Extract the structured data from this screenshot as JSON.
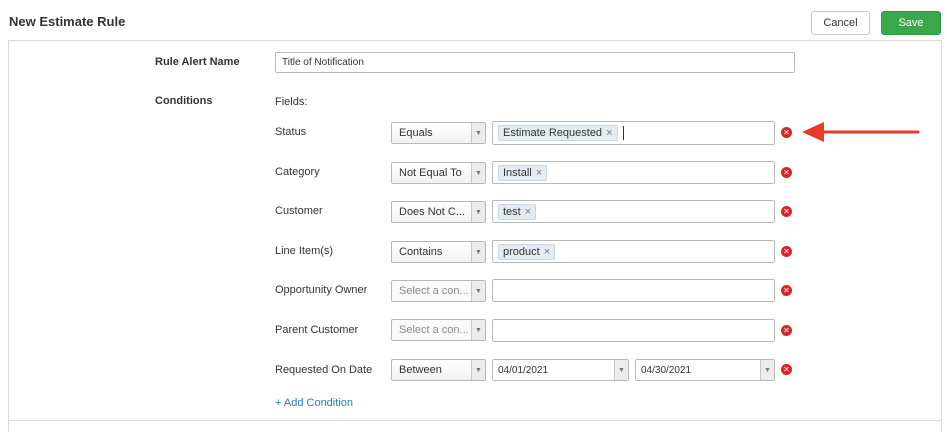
{
  "header": {
    "title": "New Estimate Rule",
    "cancel_label": "Cancel",
    "save_label": "Save"
  },
  "form": {
    "rule_alert_name_label": "Rule Alert Name",
    "rule_alert_name_value": "Title of Notification",
    "conditions_label": "Conditions",
    "fields_label": "Fields:",
    "rows": [
      {
        "field": "Status",
        "operator": "Equals",
        "tags": [
          "Estimate Requested"
        ],
        "caret": true
      },
      {
        "field": "Category",
        "operator": "Not Equal To",
        "tags": [
          "Install"
        ]
      },
      {
        "field": "Customer",
        "operator": "Does Not C...",
        "tags": [
          "test"
        ]
      },
      {
        "field": "Line Item(s)",
        "operator": "Contains",
        "tags": [
          "product"
        ]
      },
      {
        "field": "Opportunity Owner",
        "operator": "Select a con...",
        "tags": []
      },
      {
        "field": "Parent Customer",
        "operator": "Select a con...",
        "tags": []
      },
      {
        "field": "Requested On Date",
        "operator": "Between",
        "date_from": "04/01/2021",
        "date_to": "04/30/2021"
      }
    ],
    "add_condition_label": "+ Add Condition"
  },
  "icons": {
    "remove": "remove-circle-icon",
    "dropdown": "dropdown-arrow-icon",
    "tag_remove": "tag-remove-icon"
  },
  "colors": {
    "save_green": "#3aa84a",
    "remove_red": "#d9232a",
    "annotation_red": "#e8392b",
    "link_blue": "#2b7bbf"
  }
}
